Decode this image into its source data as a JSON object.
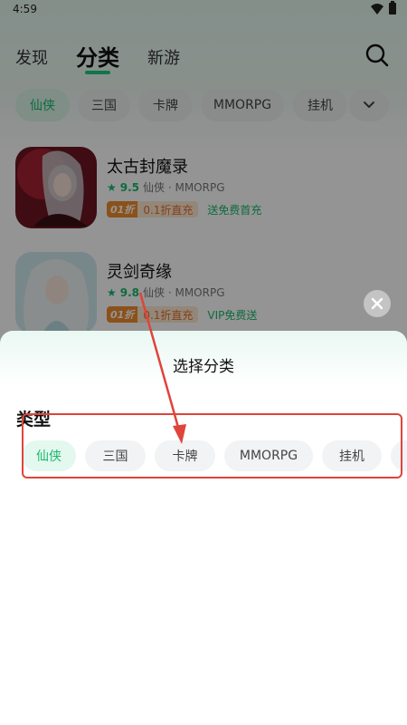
{
  "status": {
    "time": "4:59"
  },
  "nav": {
    "tabs": [
      {
        "label": "发现"
      },
      {
        "label": "分类"
      },
      {
        "label": "新游"
      }
    ]
  },
  "filters": [
    {
      "label": "仙侠"
    },
    {
      "label": "三国"
    },
    {
      "label": "卡牌"
    },
    {
      "label": "MMORPG"
    },
    {
      "label": "挂机"
    }
  ],
  "games": [
    {
      "title": "太古封魔录",
      "rating": "9.5",
      "meta": "仙侠 · MMORPG",
      "discount_badge": "01折",
      "discount_text": "0.1折直充",
      "gift": "送免费首充"
    },
    {
      "title": "灵剑奇缘",
      "rating": "9.8",
      "meta": "仙侠 · MMORPG",
      "discount_badge": "01折",
      "discount_text": "0.1折直充",
      "gift": "VIP免费送"
    }
  ],
  "sheet": {
    "title": "选择分类",
    "section_title": "类型",
    "chips": [
      {
        "label": "仙侠"
      },
      {
        "label": "三国"
      },
      {
        "label": "卡牌"
      },
      {
        "label": "MMORPG"
      },
      {
        "label": "挂机"
      }
    ]
  },
  "colors": {
    "accent": "#19b86b",
    "annotation": "#e0443a",
    "discount": "#f08c2b"
  }
}
